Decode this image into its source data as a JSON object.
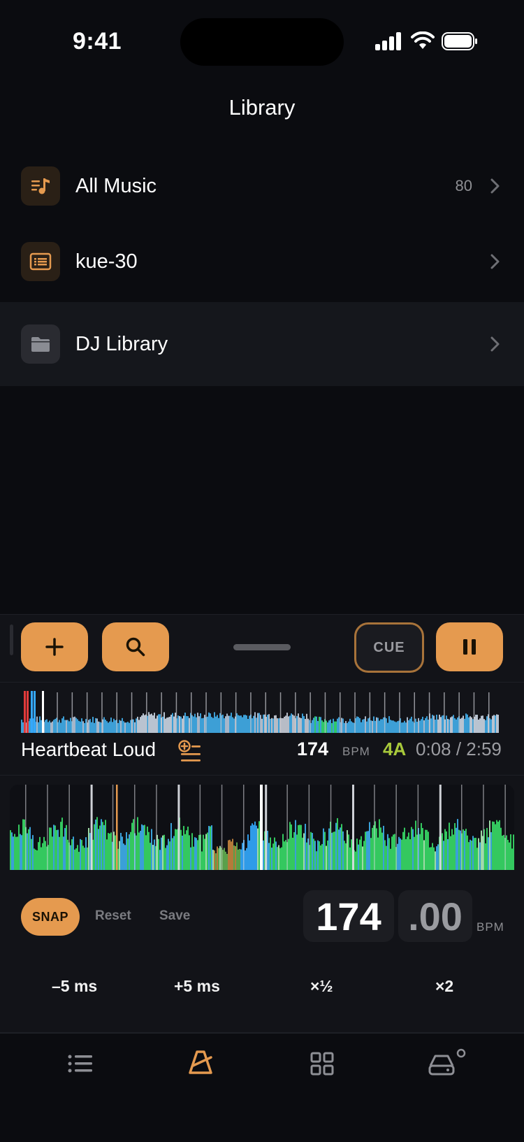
{
  "status_bar": {
    "time": "9:41"
  },
  "header": {
    "title": "Library"
  },
  "library": {
    "items": [
      {
        "label": "All Music",
        "count": "80",
        "icon": "music-list-icon"
      },
      {
        "label": "kue-30",
        "count": "",
        "icon": "playlist-icon"
      },
      {
        "label": "DJ Library",
        "count": "",
        "icon": "folder-icon",
        "selected": true
      }
    ]
  },
  "player": {
    "cue_label": "CUE",
    "track": {
      "title": "Heartbeat Loud",
      "bpm": "174",
      "bpm_label": "BPM",
      "key": "4A",
      "time": "0:08 / 2:59",
      "progress": 0.045
    },
    "beatgrid": {
      "snap_label": "SNAP",
      "reset_label": "Reset",
      "save_label": "Save",
      "bpm_int": "174",
      "bpm_dec": ".00",
      "bpm_unit": "BPM",
      "nudges": [
        "–5 ms",
        "+5 ms",
        "×½",
        "×2"
      ]
    }
  },
  "tabbar": {
    "tabs": [
      "list-icon",
      "metronome-icon",
      "grid-icon",
      "device-icon"
    ],
    "active_tab": 1
  },
  "colors": {
    "accent": "#e59a4f",
    "key_green": "#a8c93b",
    "background": "#0b0c10",
    "panel": "#121318"
  }
}
